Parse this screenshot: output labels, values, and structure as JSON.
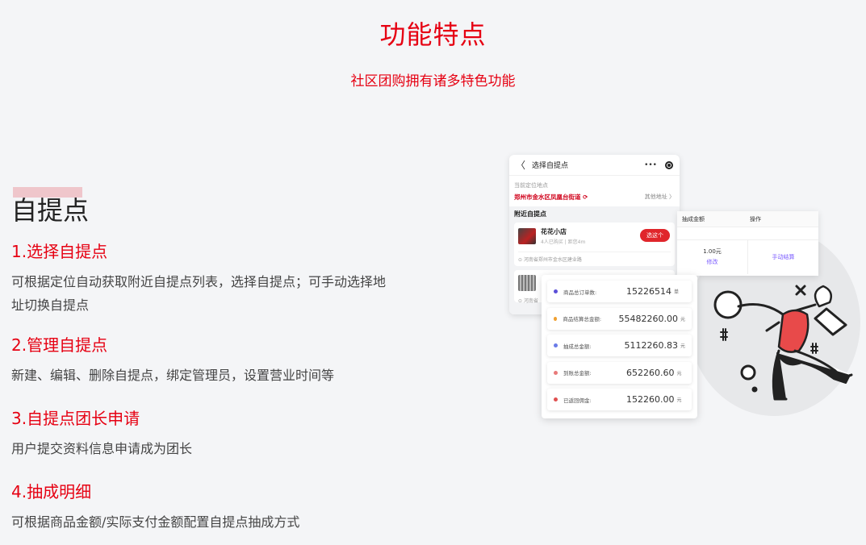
{
  "header": {
    "title": "功能特点",
    "subtitle": "社区团购拥有诸多特色功能"
  },
  "section": {
    "title": "自提点",
    "features": [
      {
        "title": "1.选择自提点",
        "desc": "可根据定位自动获取附近自提点列表，选择自提点；可手动选择地址切换自提点"
      },
      {
        "title": "2.管理自提点",
        "desc": "新建、编辑、删除自提点，绑定管理员，设置营业时间等"
      },
      {
        "title": "3.自提点团长申请",
        "desc": "用户提交资料信息申请成为团长"
      },
      {
        "title": "4.抽成明细",
        "desc": "可根据商品金额/实际支付金额配置自提点抽成方式"
      }
    ]
  },
  "phone": {
    "back": "〈",
    "title": "选择自提点",
    "more": "•••",
    "current_location_label": "当前定位地点",
    "current_address": "郑州市金水区凤凰台街道",
    "refresh": "⟳",
    "other_address": "其他地址 〉",
    "nearby_title": "附近自提点",
    "store": {
      "name": "花花小店",
      "meta": "4人已购买 | 距您4m",
      "button": "选这个",
      "address": "⊙ 河南省郑州市金水区建业路"
    },
    "store2_address": "⊙ 河南省"
  },
  "commission": {
    "col1": "抽成金额",
    "col2": "操作",
    "amount": "1.00元",
    "edit": "修改",
    "action": "手动结算"
  },
  "stats": [
    {
      "label": "商品总订单数:",
      "value": "15226514",
      "unit": "单",
      "color": "#5b4fd8"
    },
    {
      "label": "商品结算总金额:",
      "value": "55482260.00",
      "unit": "元",
      "color": "#f0a030"
    },
    {
      "label": "抽成总金额:",
      "value": "5112260.83",
      "unit": "元",
      "color": "#6a7be8"
    },
    {
      "label": "到账总金额:",
      "value": "652260.60",
      "unit": "元",
      "color": "#e87a7a"
    },
    {
      "label": "已返回佣金:",
      "value": "152260.00",
      "unit": "元",
      "color": "#e05050"
    }
  ]
}
